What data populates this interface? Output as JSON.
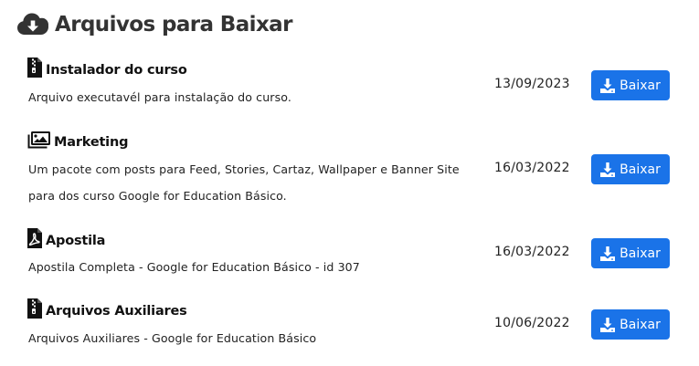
{
  "header": {
    "title": "Arquivos para Baixar",
    "icon": "cloud-download-icon"
  },
  "colors": {
    "button_bg": "#1a73e8",
    "text": "#222222"
  },
  "files": [
    {
      "icon": "file-zip-icon",
      "title": "Instalador do curso",
      "description": "Arquivo executavél para instalação do curso.",
      "date": "13/09/2023",
      "button_label": "Baixar"
    },
    {
      "icon": "images-icon",
      "title": "Marketing",
      "description": "Um pacote com posts para Feed, Stories, Cartaz, Wallpaper e Banner Site para dos curso Google for Education Básico.",
      "date": "16/03/2022",
      "button_label": "Baixar"
    },
    {
      "icon": "file-pdf-icon",
      "title": "Apostila",
      "description": "Apostila Completa - Google for Education Básico - id 307",
      "date": "16/03/2022",
      "button_label": "Baixar"
    },
    {
      "icon": "file-zip-icon",
      "title": "Arquivos Auxiliares",
      "description": "Arquivos Auxiliares - Google for Education Básico",
      "date": "10/06/2022",
      "button_label": "Baixar"
    }
  ]
}
